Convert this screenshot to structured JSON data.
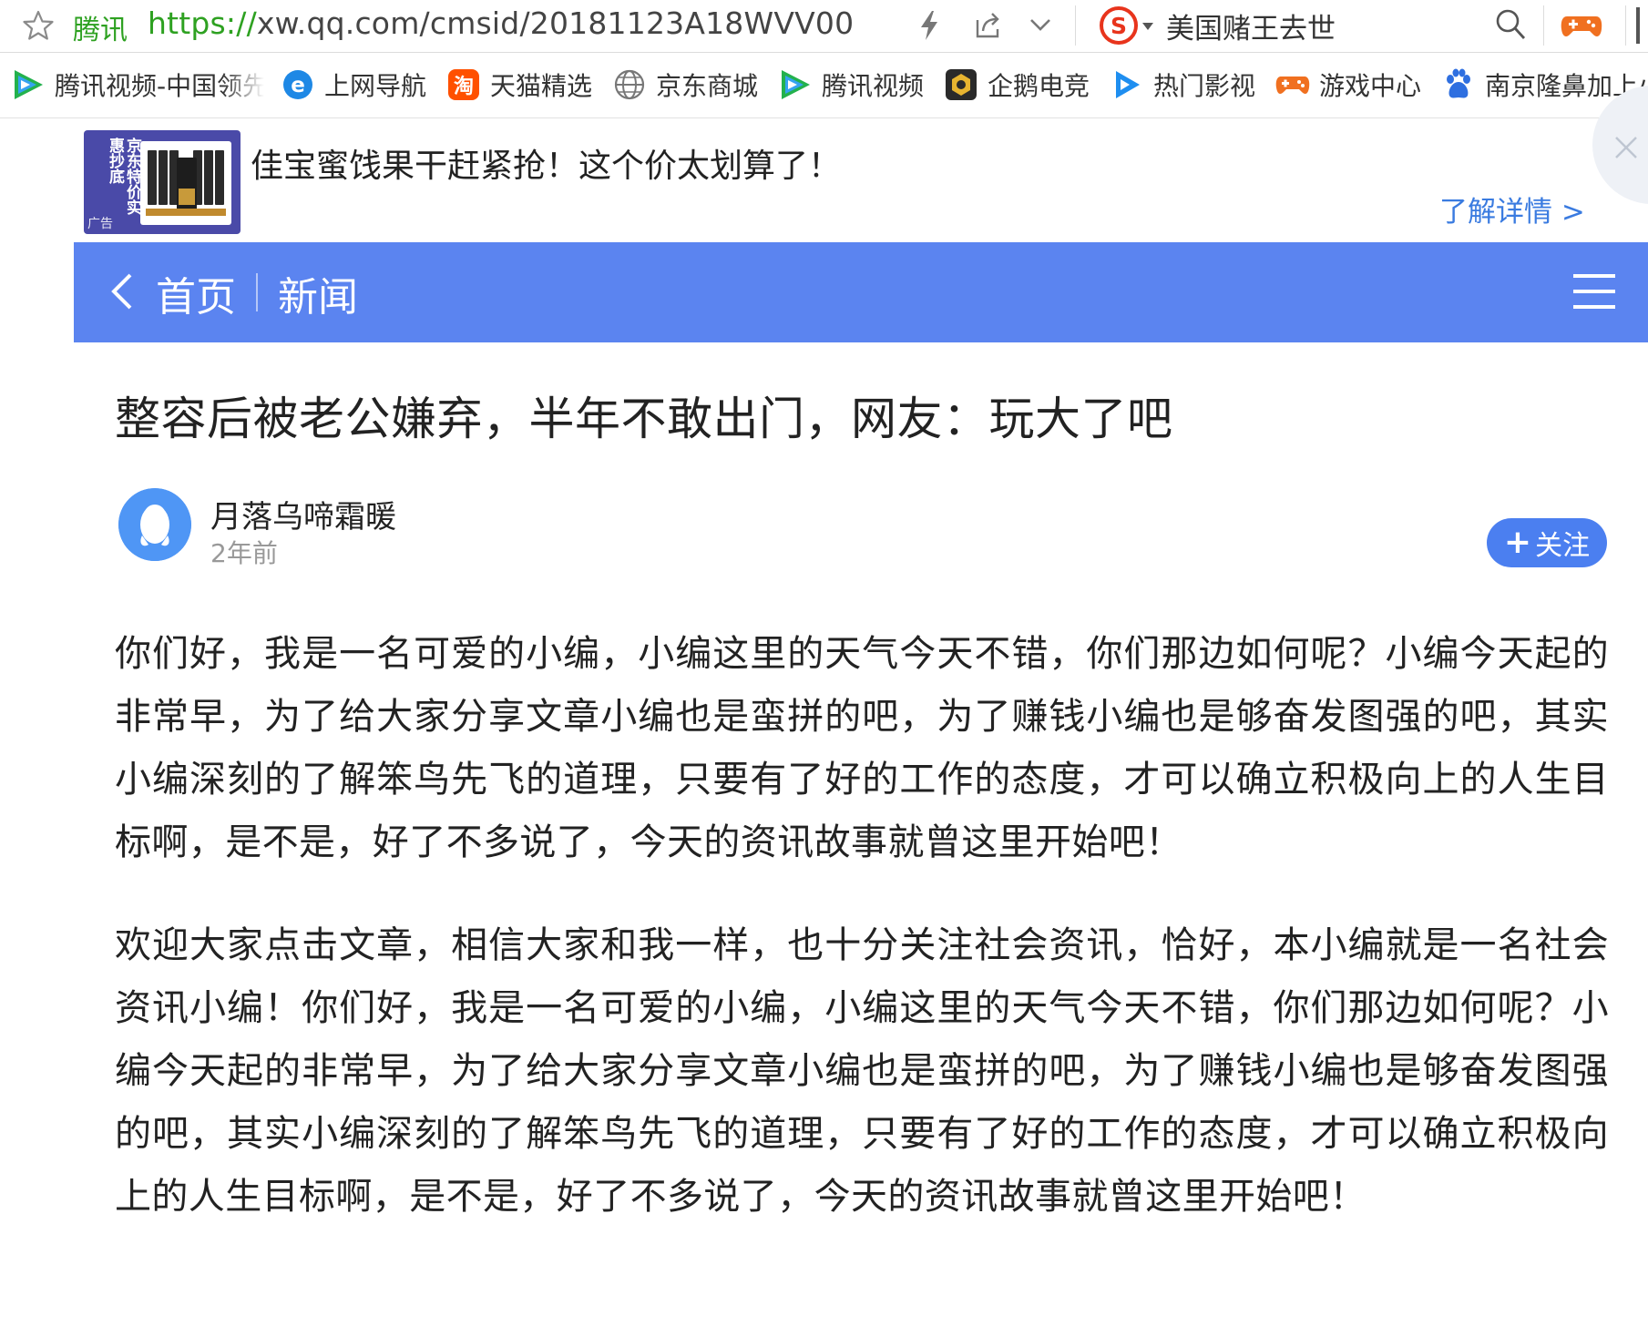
{
  "browser": {
    "site_name": "腾讯",
    "url_scheme": "https://",
    "url_rest": "xw.qq.com/cmsid/20181123A18WVV00",
    "hot_search": "美国赌王去世",
    "icons": [
      "star-icon",
      "bolt-icon",
      "share-icon",
      "chevron-down-icon",
      "sogou-icon",
      "search-icon",
      "game-controller-icon"
    ]
  },
  "bookmarks": [
    {
      "label": "腾讯视频-中国领先",
      "icon": "tencent-video-icon"
    },
    {
      "label": "上网导航",
      "icon": "ie-icon"
    },
    {
      "label": "天猫精选",
      "icon": "taobao-icon"
    },
    {
      "label": "京东商城",
      "icon": "globe-icon"
    },
    {
      "label": "腾讯视频",
      "icon": "tencent-video-icon"
    },
    {
      "label": "企鹅电竞",
      "icon": "esports-icon"
    },
    {
      "label": "热门影视",
      "icon": "play-icon"
    },
    {
      "label": "游戏中心",
      "icon": "game-controller-icon"
    },
    {
      "label": "南京隆鼻加上小",
      "icon": "baidu-paw-icon"
    }
  ],
  "ad": {
    "thumb_text": "京东特价实惠抄底",
    "thumb_tag": "广告",
    "title": "佳宝蜜饯果干赶紧抢！这个价太划算了！",
    "more": "了解详情 >"
  },
  "nav": {
    "home": "首页",
    "section": "新闻"
  },
  "article": {
    "title": "整容后被老公嫌弃，半年不敢出门，网友：玩大了吧",
    "author": "月落乌啼霜暖",
    "time": "2年前",
    "follow_label": "关注",
    "paragraphs": [
      "你们好，我是一名可爱的小编，小编这里的天气今天不错，你们那边如何呢？小编今天起的非常早，为了给大家分享文章小编也是蛮拼的吧，为了赚钱小编也是够奋发图强的吧，其实小编深刻的了解笨鸟先飞的道理，只要有了好的工作的态度，才可以确立积极向上的人生目标啊，是不是，好了不多说了，今天的资讯故事就曾这里开始吧！",
      "欢迎大家点击文章，相信大家和我一样，也十分关注社会资讯，恰好，本小编就是一名社会资讯小编！你们好，我是一名可爱的小编，小编这里的天气今天不错，你们那边如何呢？小编今天起的非常早，为了给大家分享文章小编也是蛮拼的吧，为了赚钱小编也是够奋发图强的吧，其实小编深刻的了解笨鸟先飞的道理，只要有了好的工作的态度，才可以确立积极向上的人生目标啊，是不是，好了不多说了，今天的资讯故事就曾这里开始吧！"
    ]
  },
  "colors": {
    "nav_blue": "#5b84f0",
    "link_blue": "#3a7be0",
    "url_green": "#2ea121",
    "follow_blue": "#4b7ff0"
  }
}
